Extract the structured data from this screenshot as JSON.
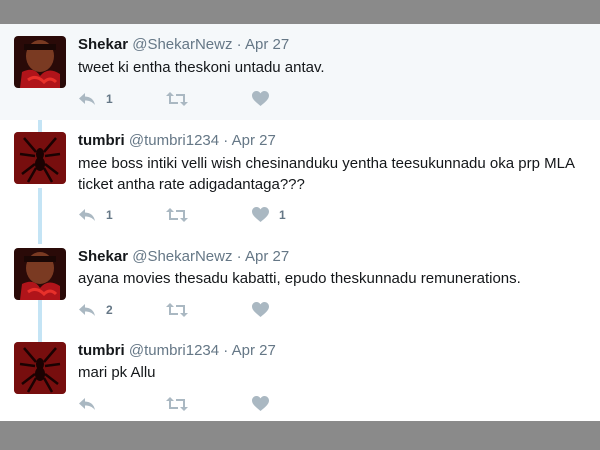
{
  "tweets": [
    {
      "name": "Shekar",
      "handle": "@ShekarNewz",
      "separator": "·",
      "date": "Apr 27",
      "text": "tweet ki entha theskoni untadu antav.",
      "reply_count": "1",
      "retweet_count": "",
      "like_count": "",
      "avatar": "portrait-avatar"
    },
    {
      "name": "tumbri",
      "handle": "@tumbri1234",
      "separator": "·",
      "date": "Apr 27",
      "text": "mee boss intiki velli wish chesinanduku yentha teesukunnadu oka prp MLA ticket antha rate adigadantaga???",
      "reply_count": "1",
      "retweet_count": "",
      "like_count": "1",
      "avatar": "spider-avatar"
    },
    {
      "name": "Shekar",
      "handle": "@ShekarNewz",
      "separator": "·",
      "date": "Apr 27",
      "text": "ayana movies thesadu kabatti, epudo theskunnadu remunerations.",
      "reply_count": "2",
      "retweet_count": "",
      "like_count": "",
      "avatar": "portrait-avatar"
    },
    {
      "name": "tumbri",
      "handle": "@tumbri1234",
      "separator": "·",
      "date": "Apr 27",
      "text": "mari pk Allu",
      "reply_count": "",
      "retweet_count": "",
      "like_count": "",
      "avatar": "spider-avatar"
    }
  ],
  "colors": {
    "text": "#14171a",
    "muted": "#657786",
    "icon": "#aab8c2",
    "thread_line": "#c4e4f5",
    "highlight_bg": "#f5f8fa",
    "band": "#8a8a8a"
  }
}
